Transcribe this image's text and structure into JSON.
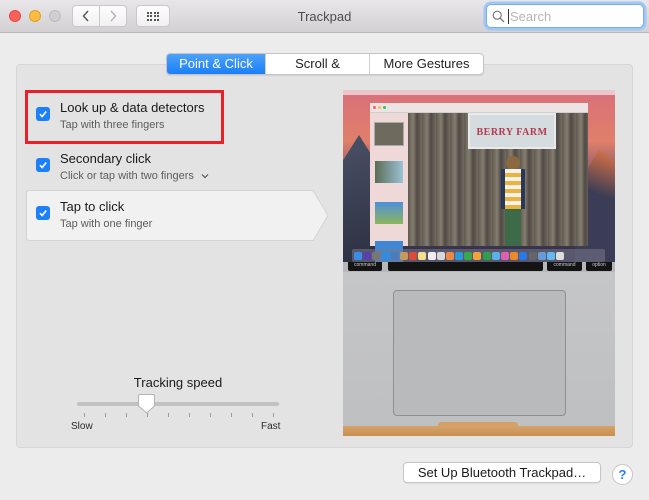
{
  "window": {
    "title": "Trackpad",
    "search": {
      "value": "",
      "placeholder": "Search"
    },
    "nav": {
      "back": "back",
      "forward": "forward",
      "grid": "show-all"
    }
  },
  "tabs": [
    {
      "label": "Point & Click",
      "active": true
    },
    {
      "label": "Scroll & Zoom",
      "active": false
    },
    {
      "label": "More Gestures",
      "active": false
    }
  ],
  "options": [
    {
      "label": "Look up & data detectors",
      "sublabel": "Tap with three fingers",
      "checked": true,
      "highlighted": true
    },
    {
      "label": "Secondary click",
      "sublabel": "Click or tap with two fingers",
      "checked": true,
      "has_dropdown": true
    },
    {
      "label": "Tap to click",
      "sublabel": "Tap with one finger",
      "checked": true,
      "selected": true
    }
  ],
  "tracking_speed": {
    "title": "Tracking speed",
    "min_label": "Slow",
    "max_label": "Fast",
    "ticks": 10,
    "value_fraction": 0.333
  },
  "preview": {
    "sign_text": "BERRY FARM",
    "keys": [
      "command",
      "command",
      "option"
    ]
  },
  "bottom": {
    "setup_button": "Set Up Bluetooth Trackpad…",
    "help": "?"
  },
  "colors": {
    "accent": "#1d80f6",
    "highlight_box": "#e8202a"
  }
}
